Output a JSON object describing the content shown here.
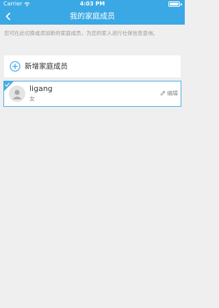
{
  "status_bar": {
    "carrier": "Carrier",
    "time": "4:03 PM",
    "wifi_icon": "wifi-icon",
    "battery_icon": "battery-icon"
  },
  "nav": {
    "back_icon": "chevron-left-icon",
    "title": "我的家庭成员"
  },
  "hint": "您可在此切换或添加新的家庭成员，为您的家人进行社保信息查询。",
  "add_member": {
    "icon": "plus-circle-icon",
    "label": "新增家庭成员"
  },
  "members": [
    {
      "name": "ligang",
      "gender": "女",
      "selected": true,
      "avatar_icon": "user-avatar-icon",
      "edit_label": "编辑",
      "edit_icon": "pencil-icon"
    }
  ],
  "colors": {
    "header": "#3aa8e5",
    "accent": "#45ace6",
    "background": "#efefef",
    "hint_text": "#9b9b9b"
  }
}
